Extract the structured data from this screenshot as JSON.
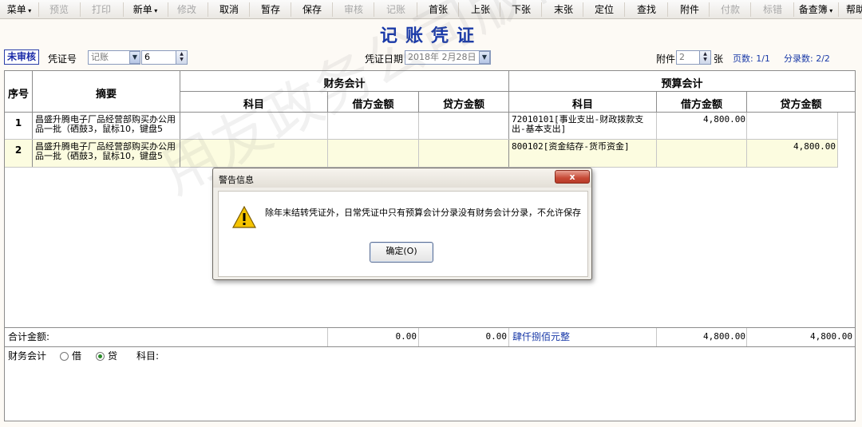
{
  "toolbar": {
    "items": [
      {
        "label": "菜单",
        "dropdown": true,
        "disabled": false
      },
      {
        "label": "预览",
        "dropdown": false,
        "disabled": true
      },
      {
        "label": "打印",
        "dropdown": false,
        "disabled": true
      },
      {
        "label": "新单",
        "dropdown": true,
        "disabled": false
      },
      {
        "label": "修改",
        "dropdown": false,
        "disabled": true
      },
      {
        "label": "取消",
        "dropdown": false,
        "disabled": false
      },
      {
        "label": "暂存",
        "dropdown": false,
        "disabled": false
      },
      {
        "label": "保存",
        "dropdown": false,
        "disabled": false
      },
      {
        "label": "审核",
        "dropdown": false,
        "disabled": true
      },
      {
        "label": "记账",
        "dropdown": false,
        "disabled": true
      },
      {
        "label": "首张",
        "dropdown": false,
        "disabled": false
      },
      {
        "label": "上张",
        "dropdown": false,
        "disabled": false
      },
      {
        "label": "下张",
        "dropdown": false,
        "disabled": false
      },
      {
        "label": "末张",
        "dropdown": false,
        "disabled": false
      },
      {
        "label": "定位",
        "dropdown": false,
        "disabled": false
      },
      {
        "label": "查找",
        "dropdown": false,
        "disabled": false
      },
      {
        "label": "附件",
        "dropdown": false,
        "disabled": false
      },
      {
        "label": "付款",
        "dropdown": false,
        "disabled": true
      },
      {
        "label": "标错",
        "dropdown": false,
        "disabled": true
      },
      {
        "label": "备查簿",
        "dropdown": true,
        "disabled": false
      },
      {
        "label": "帮助",
        "dropdown": false,
        "disabled": false
      }
    ]
  },
  "title": "记账凭证",
  "header": {
    "status_badge": "未审核",
    "voucher_no_label": "凭证号",
    "voucher_type": "记账",
    "voucher_no": "6",
    "date_label": "凭证日期",
    "date_value": "2018年 2月28日",
    "attachment_label": "附件",
    "attachment_count": "2",
    "attachment_unit": "张",
    "pages": "页数: 1/1",
    "entries": "分录数: 2/2"
  },
  "table": {
    "col_seq": "序号",
    "col_summary": "摘要",
    "group_finance": "财务会计",
    "group_budget": "预算会计",
    "sub_account": "科目",
    "sub_debit": "借方金额",
    "sub_credit": "贷方金额",
    "rows": [
      {
        "seq": "1",
        "summary": "昌盛升腾电子厂品经营部购买办公用品一批（硒鼓3，鼠标10，键盘5",
        "fin_account": "",
        "fin_debit": "",
        "fin_credit": "",
        "bud_account": "72010101[事业支出-财政拨款支出-基本支出]",
        "bud_debit": "4,800.00",
        "bud_credit": ""
      },
      {
        "seq": "2",
        "summary": "昌盛升腾电子厂品经营部购买办公用品一批（硒鼓3，鼠标10，键盘5",
        "fin_account": "",
        "fin_debit": "",
        "fin_credit": "",
        "bud_account": "800102[资金结存-货币资金]",
        "bud_debit": "",
        "bud_credit": "4,800.00"
      }
    ],
    "total_label": "合计金额:",
    "total_fin_debit": "0.00",
    "total_fin_credit": "0.00",
    "total_in_words": "肆仟捌佰元整",
    "total_bud_debit": "4,800.00",
    "total_bud_credit": "4,800.00"
  },
  "footer": {
    "section_label": "财务会计",
    "radio_debit": "借",
    "radio_credit": "贷",
    "selected": "credit",
    "account_label": "科目:"
  },
  "watermark": "用友政务公司版权所有",
  "dialog": {
    "title": "警告信息",
    "close_label": "x",
    "message": "除年末结转凭证外，日常凭证中只有预算会计分录没有财务会计分录，不允许保存",
    "ok_label": "确定(O)"
  }
}
